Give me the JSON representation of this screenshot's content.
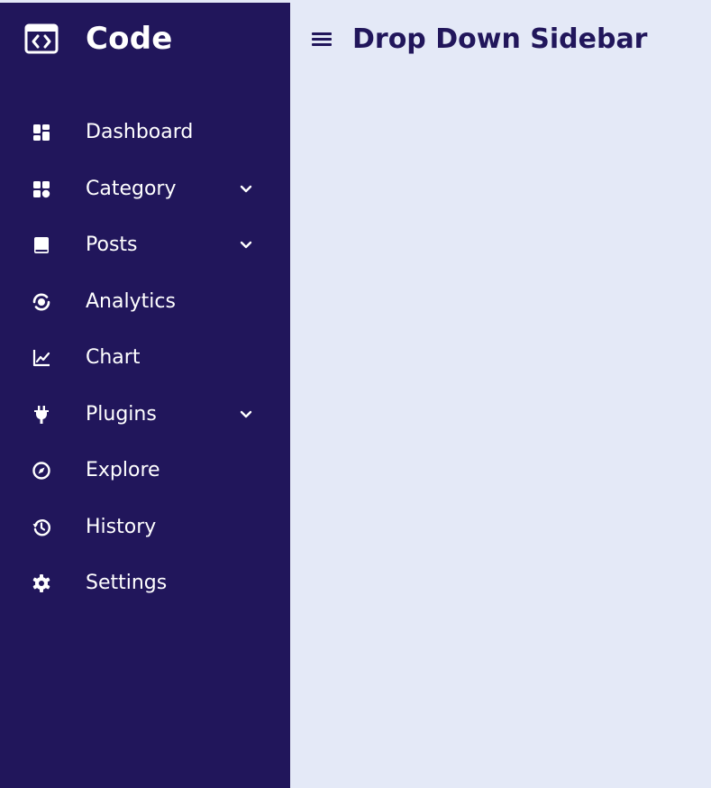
{
  "brand": {
    "name": "Code",
    "icon": "code-window-icon"
  },
  "header": {
    "title": "Drop Down Sidebar",
    "menu_icon": "hamburger-menu-icon"
  },
  "sidebar": {
    "items": [
      {
        "label": "Dashboard",
        "icon": "dashboard-grid-icon",
        "has_submenu": false
      },
      {
        "label": "Category",
        "icon": "category-grid-icon",
        "has_submenu": true
      },
      {
        "label": "Posts",
        "icon": "book-icon",
        "has_submenu": true
      },
      {
        "label": "Analytics",
        "icon": "analytics-icon",
        "has_submenu": false
      },
      {
        "label": "Chart",
        "icon": "line-chart-icon",
        "has_submenu": false
      },
      {
        "label": "Plugins",
        "icon": "plug-icon",
        "has_submenu": true
      },
      {
        "label": "Explore",
        "icon": "compass-icon",
        "has_submenu": false
      },
      {
        "label": "History",
        "icon": "history-icon",
        "has_submenu": false
      },
      {
        "label": "Settings",
        "icon": "gear-icon",
        "has_submenu": false
      }
    ]
  },
  "colors": {
    "sidebar_bg": "#21165b",
    "main_bg": "#e4e9f7",
    "sidebar_text": "#ffffff",
    "title_text": "#21165b"
  }
}
